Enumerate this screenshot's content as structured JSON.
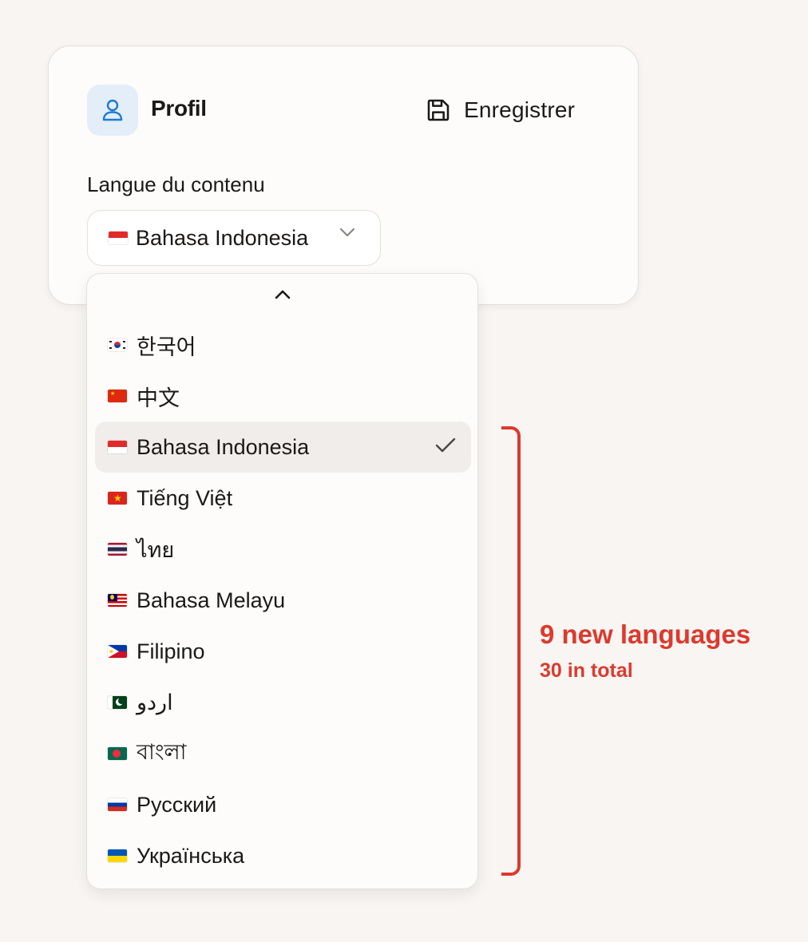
{
  "card": {
    "title": "Profil",
    "save_label": "Enregistrer",
    "field_label": "Langue du contenu",
    "selected_value": "Bahasa Indonesia",
    "selected_flag": "id"
  },
  "dropdown": {
    "options": [
      {
        "flag": "kr",
        "label": "한국어",
        "selected": false
      },
      {
        "flag": "cn",
        "label": "中文",
        "selected": false
      },
      {
        "flag": "id",
        "label": "Bahasa Indonesia",
        "selected": true
      },
      {
        "flag": "vn",
        "label": "Tiếng Việt",
        "selected": false
      },
      {
        "flag": "th",
        "label": "ไทย",
        "selected": false
      },
      {
        "flag": "my",
        "label": "Bahasa Melayu",
        "selected": false
      },
      {
        "flag": "ph",
        "label": "Filipino",
        "selected": false
      },
      {
        "flag": "pk",
        "label": "اردو",
        "selected": false
      },
      {
        "flag": "bd",
        "label": "বাংলা",
        "selected": false
      },
      {
        "flag": "ru",
        "label": "Русский",
        "selected": false
      },
      {
        "flag": "ua",
        "label": "Українська",
        "selected": false
      }
    ]
  },
  "annotation": {
    "title": "9 new languages",
    "subtitle": "30 in total",
    "color": "#dc3a2e"
  },
  "colors": {
    "accent": "#1f7ad4",
    "avatar_bg": "#e3eef8",
    "selected_bg": "#f0edea",
    "page_bg": "#f8f5f2"
  },
  "icons": {
    "avatar": "user-icon",
    "save": "floppy-disk-icon",
    "select": "chevron-down-icon",
    "scroll": "chevron-up-icon",
    "selected": "check-icon"
  }
}
